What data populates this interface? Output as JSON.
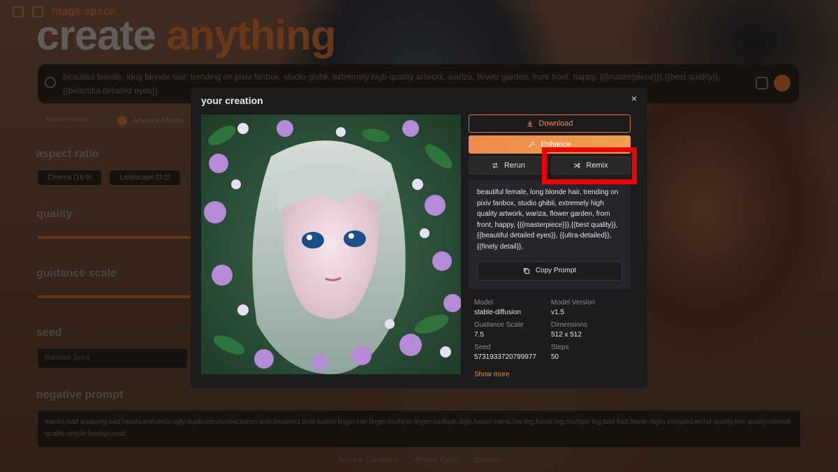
{
  "background": {
    "brand": "mage.space",
    "hero_word1": "create",
    "hero_word2": "anything",
    "search_text": "beautiful female, long blonde hair, trending on pixiv fanbox, studio ghibli, extremely high quality artwork, wariza, flower garden, from front, happy, {{{masterpiece}}},{{best quality}},{{beautiful detailed eyes}}",
    "link_new_features": "New Features",
    "link_advanced_mode": "Advanced Mode",
    "aspect_ratio_label": "aspect ratio",
    "aspect_options": [
      "Cinema (16:9)",
      "Landscape (3:2)"
    ],
    "quality_label": "quality",
    "guidance_label": "guidance scale",
    "seed_label": "seed",
    "seed_placeholder": "Random Seed",
    "negative_label": "negative prompt",
    "negative_text": "lowres,bad anatomy,bad hands,text,error,ugly,duplicate,morbid,token limit,incorrect limb,fusion finger,low finger,multiple finger,multiple digit,fusion hand,low leg,fused leg,multiple leg,bad foot,fewer digits,cropped,worst quality,low quality,normal quality,simple background.",
    "footer_links": [
      "Terms & Conditions",
      "Privacy Policy",
      "Discord"
    ]
  },
  "modal": {
    "title": "your creation",
    "close_glyph": "×",
    "download_label": "Download",
    "enhance_label": "Enhance",
    "rerun_label": "Rerun",
    "remix_label": "Remix",
    "prompt": "beautiful female, long blonde hair, trending on pixiv fanbox, studio ghibli, extremely high quality artwork, wariza, flower garden, from front, happy, {{{masterpiece}}},{{best quality}},{{beautiful detailed eyes}}, {{ultra-detailed}}, {{finely detail}},",
    "copy_prompt_label": "Copy Prompt",
    "meta": {
      "model_label": "Model",
      "model_value": "stable-diffusion",
      "model_version_label": "Model Version",
      "model_version_value": "v1.5",
      "guidance_scale_label": "Guidance Scale",
      "guidance_scale_value": "7.5",
      "dimensions_label": "Dimensions",
      "dimensions_value": "512 x 512",
      "seed_label": "Seed",
      "seed_value": "5731933720799977",
      "steps_label": "Steps",
      "steps_value": "50"
    },
    "show_more_label": "Show more"
  },
  "colors": {
    "accent": "#f08a4a",
    "highlight": "#ee0000",
    "modal_bg": "#1c1c1e"
  }
}
